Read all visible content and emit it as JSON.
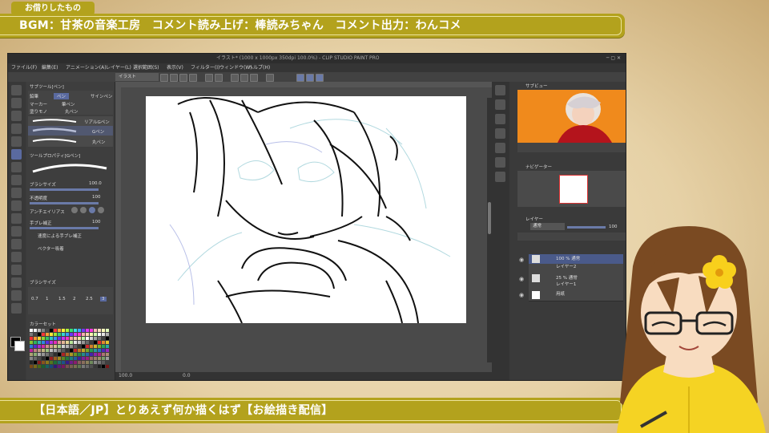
{
  "overlay": {
    "tag_label": "お借りしたもの",
    "credits": "BGM：甘茶の音楽工房　コメント読み上げ：棒読みちゃん　コメント出力：わんコメ",
    "stream_title": "【日本語／JP】とりあえず何か描くはず【お絵描き配信】"
  },
  "app": {
    "window_title": "イラスト* (1000 x 1000px 350dpi 100.0%) - CLIP STUDIO PAINT PRO",
    "menu": [
      "ファイル(F)",
      "編集(E)",
      "アニメーション(A)",
      "レイヤー(L)",
      "選択範囲(S)",
      "表示(V)",
      "フィルター(I)",
      "ウィンドウ(W)",
      "ヘルプ(H)"
    ],
    "doc_tab": "イラスト",
    "subtool_panel": {
      "title": "サブツール[ペン]",
      "tabs": [
        "鉛筆",
        "ペン",
        "マーカー",
        "筆ペン",
        "サインペン",
        "塗りモノ",
        "丸ペン",
        "GペンA"
      ],
      "brushes": [
        "リアルGペン",
        "Gペン",
        "丸ペン"
      ]
    },
    "tool_property": {
      "title": "ツールプロパティ[Gペン]",
      "brush_size_label": "ブラシサイズ",
      "brush_size_value": "100.0",
      "opacity_label": "不透明度",
      "opacity_value": "100",
      "antialias_label": "アンチエイリアス",
      "stabilization_label": "手ブレ補正",
      "stabilization_value": "100",
      "speed_stab_label": "速度による手ブレ補正",
      "vector_label": "ベクター吸着"
    },
    "brush_size_panel": {
      "title": "ブラシサイズ",
      "values": [
        "0.7",
        "1",
        "1.5",
        "2",
        "2.5",
        "3"
      ]
    },
    "color_set_title": "カラーセット",
    "canvas_zoom": "100.0",
    "canvas_angle": "0.0",
    "navigator_title": "ナビゲーター",
    "subview_title": "サブビュー",
    "layer_panel": {
      "title": "レイヤー",
      "blend": "通常",
      "opacity": "100",
      "layers": [
        {
          "name": "100 % 通常",
          "sub": "レイヤー2"
        },
        {
          "name": "25 % 通常",
          "sub": "レイヤー1"
        },
        {
          "name": "用紙",
          "sub": ""
        }
      ]
    }
  },
  "colors": {
    "banner": "#b3a21d",
    "parchment": "#e6d1a6",
    "orange_bg": "#f08a1c",
    "character_yellow": "#f5d323"
  }
}
